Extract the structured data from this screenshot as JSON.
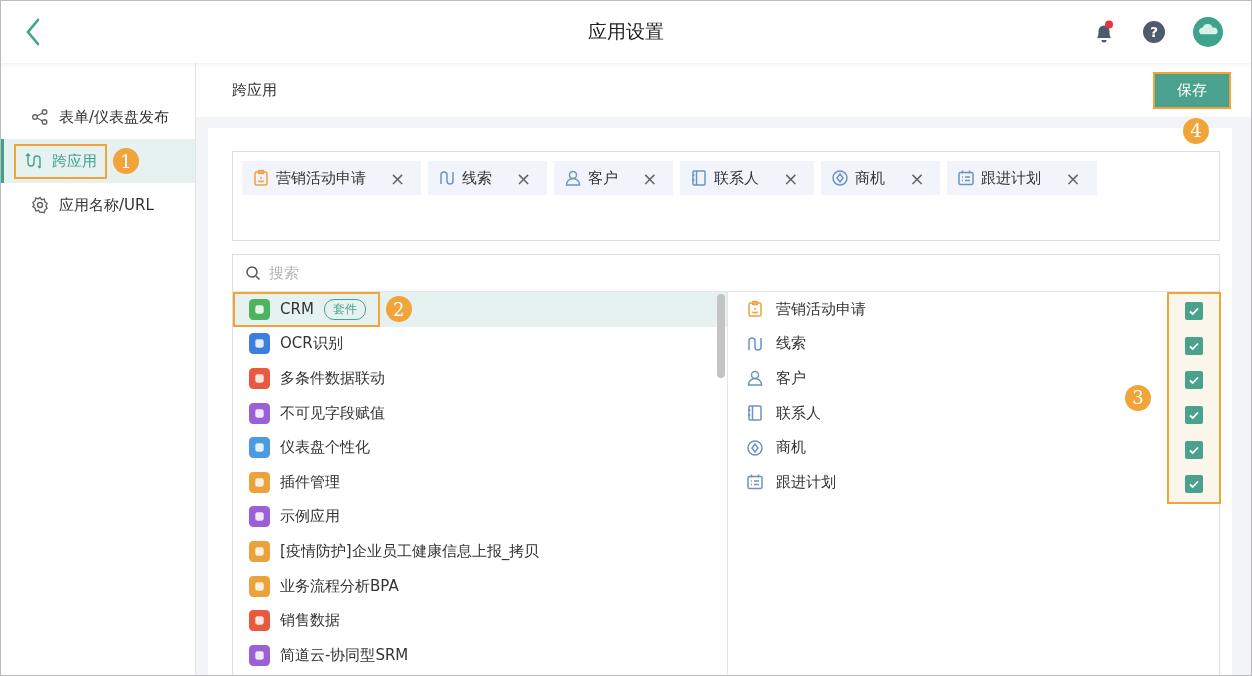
{
  "header": {
    "title": "应用设置",
    "help": "?",
    "notification_dot": true
  },
  "sidebar": {
    "items": [
      {
        "label": "表单/仪表盘发布",
        "kind": "share",
        "selected": false
      },
      {
        "label": "跨应用",
        "kind": "route",
        "selected": true,
        "callout": "1"
      },
      {
        "label": "应用名称/URL",
        "kind": "gear",
        "selected": false
      }
    ]
  },
  "content": {
    "title": "跨应用",
    "save": {
      "label": "保存",
      "callout": "4"
    }
  },
  "chosen_tags": [
    {
      "label": "营销活动申请",
      "kind": "clipboard",
      "remove": "×"
    },
    {
      "label": "线索",
      "kind": "route",
      "remove": "×"
    },
    {
      "label": "客户",
      "kind": "person",
      "remove": "×"
    },
    {
      "label": "联系人",
      "kind": "book",
      "remove": "×"
    },
    {
      "label": "商机",
      "kind": "compass",
      "remove": "×"
    },
    {
      "label": "跟进计划",
      "kind": "calendar",
      "remove": "×"
    }
  ],
  "search": {
    "placeholder": "搜索"
  },
  "apps": [
    {
      "label": "CRM",
      "badge": "套件",
      "color": "#4cb35f",
      "selected": true,
      "callout": "2"
    },
    {
      "label": "OCR识别",
      "color": "#3d7fe0",
      "selected": false
    },
    {
      "label": "多条件数据联动",
      "color": "#e8593f",
      "selected": false
    },
    {
      "label": "不可见字段赋值",
      "color": "#9b5fd6",
      "selected": false
    },
    {
      "label": "仪表盘个性化",
      "color": "#4a9be0",
      "selected": false
    },
    {
      "label": "插件管理",
      "color": "#eba23a",
      "selected": false
    },
    {
      "label": "示例应用",
      "color": "#9b5fd6",
      "selected": false
    },
    {
      "label": "[疫情防护]企业员工健康信息上报_拷贝",
      "color": "#eba23a",
      "selected": false
    },
    {
      "label": "业务流程分析BPA",
      "color": "#eba23a",
      "selected": false
    },
    {
      "label": "销售数据",
      "color": "#e8593f",
      "selected": false
    },
    {
      "label": "简道云-协同型SRM",
      "color": "#9b5fd6",
      "selected": false
    }
  ],
  "forms": {
    "callout": "3",
    "items": [
      {
        "label": "营销活动申请",
        "kind": "clipboard",
        "checked": true
      },
      {
        "label": "线索",
        "kind": "route",
        "checked": true
      },
      {
        "label": "客户",
        "kind": "person",
        "checked": true
      },
      {
        "label": "联系人",
        "kind": "book",
        "checked": true
      },
      {
        "label": "商机",
        "kind": "compass",
        "checked": true
      },
      {
        "label": "跟进计划",
        "kind": "calendar",
        "checked": true
      }
    ]
  }
}
